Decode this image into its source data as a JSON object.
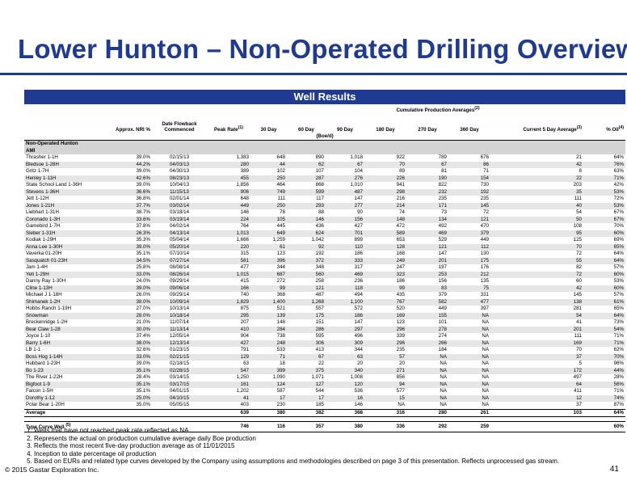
{
  "title": "Lower Hunton – Non-Operated Drilling Overview",
  "banner": "Well Results",
  "header": {
    "cumulative": "Cumulative Production Averages",
    "cumulative_sup": "(2)",
    "nri": "Approx. NRI %",
    "flowback": "Date Flowback Commenced",
    "peak": "Peak Rate",
    "peak_sup": "(1)",
    "d30": "30 Day",
    "d60": "60 Day",
    "d90": "90 Day",
    "d180": "180 Day",
    "d270": "270 Day",
    "d360": "360 Day",
    "current": "Current 5 Day Average",
    "current_sup": "(3)",
    "oil": "% Oil",
    "oil_sup": "(4)",
    "units": "(Boe/d)"
  },
  "section": "Non-Operated Hunton",
  "subsection": "AMI",
  "wells": [
    [
      "Thrasher 1-1H",
      "39.0%",
      "02/15/13",
      "1,383",
      "648",
      "890",
      "1,018",
      "922",
      "789",
      "676",
      "21",
      "64%"
    ],
    [
      "Bledsoe 1-28H",
      "44.2%",
      "04/03/13",
      "280",
      "44",
      "62",
      "67",
      "70",
      "67",
      "86",
      "42",
      "76%"
    ],
    [
      "Gritz 1-7H",
      "39.0%",
      "04/30/13",
      "389",
      "102",
      "107",
      "104",
      "89",
      "81",
      "71",
      "8",
      "63%"
    ],
    [
      "Henley 1-11H",
      "42.6%",
      "08/23/13",
      "455",
      "250",
      "287",
      "276",
      "226",
      "190",
      "154",
      "22",
      "71%"
    ],
    [
      "State School Land 1-36H",
      "39.0%",
      "10/04/13",
      "1,856",
      "464",
      "868",
      "1,010",
      "941",
      "822",
      "730",
      "203",
      "42%"
    ],
    [
      "Stevens 1-36H",
      "36.6%",
      "11/15/13",
      "906",
      "749",
      "599",
      "487",
      "298",
      "232",
      "192",
      "35",
      "53%"
    ],
    [
      "Jett 1-12H",
      "36.8%",
      "02/01/14",
      "648",
      "111",
      "117",
      "147",
      "216",
      "235",
      "235",
      "111",
      "72%"
    ],
    [
      "Jones 1-21H",
      "37.7%",
      "03/02/14",
      "449",
      "250",
      "293",
      "277",
      "214",
      "171",
      "145",
      "40",
      "53%"
    ],
    [
      "Liebhart 1-31H",
      "38.7%",
      "03/18/14",
      "146",
      "78",
      "88",
      "90",
      "74",
      "73",
      "72",
      "54",
      "67%"
    ],
    [
      "Coronado 1-3H",
      "33.6%",
      "03/19/14",
      "224",
      "105",
      "146",
      "156",
      "148",
      "134",
      "121",
      "50",
      "67%"
    ],
    [
      "Gamebird 1-7H",
      "37.8%",
      "04/02/14",
      "764",
      "445",
      "436",
      "427",
      "472",
      "492",
      "470",
      "108",
      "70%"
    ],
    [
      "Sieber 1-31H",
      "26.3%",
      "04/13/14",
      "1,013",
      "649",
      "624",
      "701",
      "589",
      "469",
      "379",
      "95",
      "60%"
    ],
    [
      "Kodiak 1-29H",
      "35.3%",
      "05/04/14",
      "1,666",
      "1,259",
      "1,042",
      "899",
      "653",
      "529",
      "449",
      "125",
      "69%"
    ],
    [
      "Anna Lee 1-30H",
      "39.0%",
      "05/20/14",
      "220",
      "61",
      "92",
      "110",
      "128",
      "121",
      "112",
      "70",
      "65%"
    ],
    [
      "Vaverka 01-20H",
      "35.1%",
      "07/10/14",
      "315",
      "123",
      "192",
      "186",
      "168",
      "147",
      "130",
      "72",
      "64%"
    ],
    [
      "Sasquatch 01-23H",
      "34.5%",
      "07/27/14",
      "581",
      "396",
      "372",
      "333",
      "249",
      "201",
      "175",
      "55",
      "64%"
    ],
    [
      "Jam 1-4H",
      "25.8%",
      "08/08/14",
      "477",
      "344",
      "348",
      "317",
      "247",
      "197",
      "176",
      "82",
      "57%"
    ],
    [
      "Yeti 1-29H",
      "33.0%",
      "08/26/14",
      "1,015",
      "687",
      "560",
      "469",
      "323",
      "253",
      "212",
      "72",
      "60%"
    ],
    [
      "Danny Ray 1-30H",
      "24.0%",
      "09/29/14",
      "415",
      "272",
      "258",
      "236",
      "186",
      "156",
      "135",
      "60",
      "53%"
    ],
    [
      "Cline 1-13H",
      "39.0%",
      "09/06/14",
      "166",
      "99",
      "121",
      "118",
      "99",
      "83",
      "75",
      "42",
      "60%"
    ],
    [
      "Michael J 1-18H",
      "26.0%",
      "09/29/14",
      "740",
      "368",
      "487",
      "494",
      "435",
      "379",
      "331",
      "145",
      "57%"
    ],
    [
      "Shimanek 1-2H",
      "38.0%",
      "10/09/14",
      "1,829",
      "1,400",
      "1,268",
      "1,100",
      "767",
      "582",
      "477",
      "138",
      "61%"
    ],
    [
      "Hobbs Ranch 1-19H",
      "27.0%",
      "10/13/14",
      "875",
      "521",
      "557",
      "572",
      "520",
      "449",
      "397",
      "281",
      "65%"
    ],
    [
      "Snowman",
      "28.0%",
      "10/18/14",
      "295",
      "139",
      "175",
      "186",
      "169",
      "155",
      "NA",
      "54",
      "64%"
    ],
    [
      "Breckenridge 1-2H",
      "21.0%",
      "11/07/14",
      "207",
      "148",
      "151",
      "147",
      "123",
      "101",
      "NA",
      "41",
      "73%"
    ],
    [
      "Bear Claw 1-28",
      "30.0%",
      "11/13/14",
      "410",
      "284",
      "286",
      "297",
      "296",
      "278",
      "NA",
      "201",
      "54%"
    ],
    [
      "Joyce 1-10",
      "37.4%",
      "12/05/14",
      "904",
      "738",
      "595",
      "496",
      "339",
      "274",
      "NA",
      "111",
      "71%"
    ],
    [
      "Barry 1-6H",
      "38.0%",
      "12/13/14",
      "427",
      "248",
      "306",
      "309",
      "296",
      "266",
      "NA",
      "169",
      "71%"
    ],
    [
      "LB 1-1",
      "32.6%",
      "01/23/15",
      "791",
      "533",
      "413",
      "344",
      "235",
      "184",
      "NA",
      "70",
      "62%"
    ],
    [
      "Boss Hog 1-14H",
      "33.0%",
      "02/21/15",
      "129",
      "71",
      "67",
      "63",
      "57",
      "NA",
      "NA",
      "37",
      "70%"
    ],
    [
      "Hubbard 1-23H",
      "39.0%",
      "02/18/15",
      "63",
      "18",
      "22",
      "20",
      "20",
      "NA",
      "NA",
      "5",
      "96%"
    ],
    [
      "Bo 1-23",
      "35.1%",
      "02/28/15",
      "547",
      "399",
      "375",
      "340",
      "271",
      "NA",
      "NA",
      "172",
      "44%"
    ],
    [
      "The River 1-22H",
      "28.4%",
      "03/14/15",
      "1,250",
      "1,090",
      "1,071",
      "1,008",
      "856",
      "NA",
      "NA",
      "497",
      "28%"
    ],
    [
      "Bigfoot 1-9",
      "35.1%",
      "03/17/15",
      "161",
      "124",
      "127",
      "120",
      "94",
      "NA",
      "NA",
      "64",
      "56%"
    ],
    [
      "Falcon 1-5H",
      "35.1%",
      "04/01/15",
      "1,202",
      "587",
      "544",
      "536",
      "577",
      "NA",
      "NA",
      "411",
      "71%"
    ],
    [
      "Dorothy 1-12",
      "25.0%",
      "04/10/15",
      "41",
      "17",
      "17",
      "16",
      "15",
      "NA",
      "NA",
      "12",
      "74%"
    ],
    [
      "Polar Bear 1-20H",
      "35.0%",
      "05/05/15",
      "403",
      "230",
      "185",
      "146",
      "NA",
      "NA",
      "NA",
      "37",
      "87%"
    ]
  ],
  "average": {
    "label": "Average",
    "values": [
      "639",
      "380",
      "382",
      "368",
      "316",
      "280",
      "261",
      "103",
      "64%"
    ]
  },
  "type_curve": {
    "label": "Type Curve Well",
    "sup": "(5)",
    "values": [
      "746",
      "116",
      "357",
      "380",
      "336",
      "292",
      "259",
      "",
      "60%"
    ]
  },
  "notes": [
    "Wells that have not reached peak rate reflected as NA",
    "Represents the actual on production cumulative average daily Boe production",
    "Reflects the most recent five-day production average as of 11/01/2015",
    "Inception to date percentage oil production",
    "Based on EURs and related type curves developed by the Company using assumptions and methodologies described on page 3 of this presentation. Reflects unprocessed gas stream."
  ],
  "copyright": "© 2015 Gastar Exploration Inc.",
  "page_number": "41"
}
